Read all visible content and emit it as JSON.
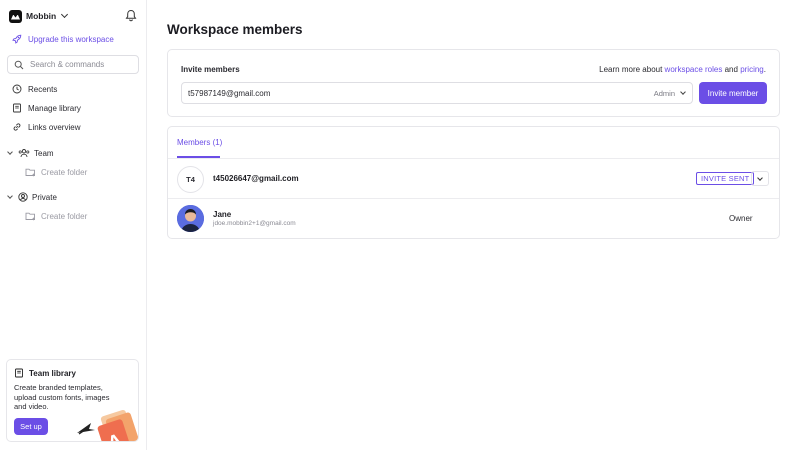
{
  "workspace": {
    "name": "Mobbin"
  },
  "sidebar": {
    "upgrade_label": "Upgrade this workspace",
    "search_placeholder": "Search & commands",
    "items": [
      {
        "label": "Recents",
        "icon": "clock-icon"
      },
      {
        "label": "Manage library",
        "icon": "library-icon"
      },
      {
        "label": "Links overview",
        "icon": "link-icon"
      }
    ],
    "sections": [
      {
        "label": "Team",
        "icon": "team-icon",
        "create_label": "Create folder"
      },
      {
        "label": "Private",
        "icon": "user-circle-icon",
        "create_label": "Create folder"
      }
    ],
    "team_library": {
      "title": "Team library",
      "description": "Create branded templates, upload custom fonts, images and video.",
      "button_label": "Set up"
    }
  },
  "main": {
    "title": "Workspace members",
    "invite": {
      "label": "Invite members",
      "learn_prefix": "Learn more about",
      "link_roles": "workspace roles",
      "learn_and": "and",
      "link_pricing": "pricing",
      "learn_suffix": ".",
      "email_value": "t57987149@gmail.com",
      "role_value": "Admin",
      "button_label": "Invite member"
    },
    "members": {
      "tab_label": "Members (1)",
      "rows": [
        {
          "initials": "T4",
          "email": "t45026647@gmail.com",
          "status": "INVITE SENT"
        },
        {
          "name": "Jane",
          "email": "jdoe.mobbin2+1@gmail.com",
          "role": "Owner"
        }
      ]
    }
  },
  "colors": {
    "accent": "#6b4ee6",
    "border": "#e6e6ea"
  }
}
